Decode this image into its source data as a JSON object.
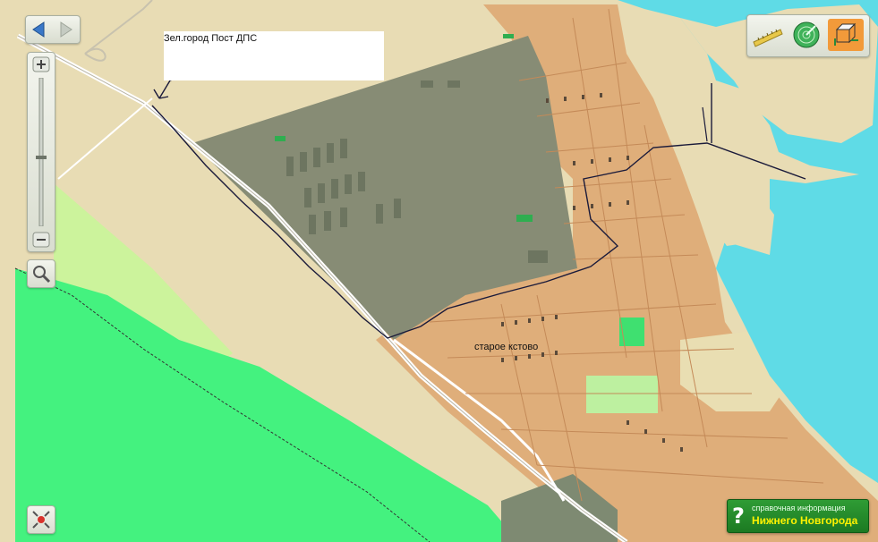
{
  "map": {
    "annotation": "Зел.город Пост ДПС",
    "place_label": "старое кстово"
  },
  "info_banner": {
    "line1": "справочная информация",
    "line2": "Нижнего Новгорода"
  },
  "toolbar": {
    "tools": [
      "ruler-icon",
      "radar-icon",
      "3d-box-icon"
    ],
    "active_tool": "3d-box-icon"
  },
  "colors": {
    "water": "#5fdbe6",
    "forest": "#44f27f",
    "light_green": "#ccf39c",
    "sand": "#e8dcb4",
    "urban": "#dfae7a",
    "dark_zone": "#878c75",
    "accent_orange": "#f29a3a"
  }
}
